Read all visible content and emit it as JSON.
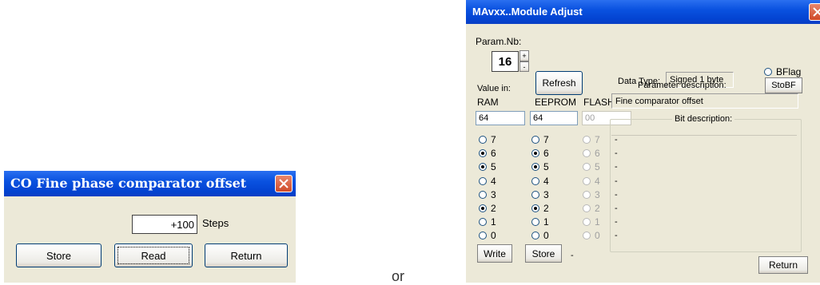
{
  "win1": {
    "title": "CO Fine phase comparator offset",
    "value": "+100",
    "unit": "Steps",
    "buttons": {
      "store": "Store",
      "read": "Read",
      "return": "Return"
    }
  },
  "separator_text": "or",
  "win2": {
    "title": "MAvxx..Module Adjust",
    "param_label": "Param.Nb:",
    "param_value": "16",
    "spin_up": "+",
    "spin_down": "-",
    "refresh_label": "Refresh",
    "data_type_label": "Data Type:",
    "data_type_value": "Signed 1 byte",
    "bflag_label": "BFlag",
    "stobf_label": "StoBF",
    "param_desc_label": "Parameter description:",
    "param_desc_value": "Fine comparator offset",
    "value_in_label": "Value in:",
    "col_ram": "RAM",
    "col_eeprom": "EEPROM",
    "col_flash": "FLASH",
    "ram_value": "64",
    "eeprom_value": "64",
    "flash_value": "00",
    "bit_desc_label": "Bit description:",
    "bits": [
      "7",
      "6",
      "5",
      "4",
      "3",
      "2",
      "1",
      "0"
    ],
    "ram_bits_on": [
      false,
      true,
      true,
      false,
      false,
      true,
      false,
      false
    ],
    "eeprom_bits_on": [
      false,
      true,
      true,
      false,
      false,
      true,
      false,
      false
    ],
    "flash_bits_on": [
      false,
      false,
      false,
      false,
      false,
      false,
      false,
      false
    ],
    "bit_descriptions": [
      "-",
      "-",
      "-",
      "-",
      "-",
      "-",
      "-",
      "-"
    ],
    "write_label": "Write",
    "store_label": "Store",
    "status_text": "-",
    "return_label": "Return"
  }
}
